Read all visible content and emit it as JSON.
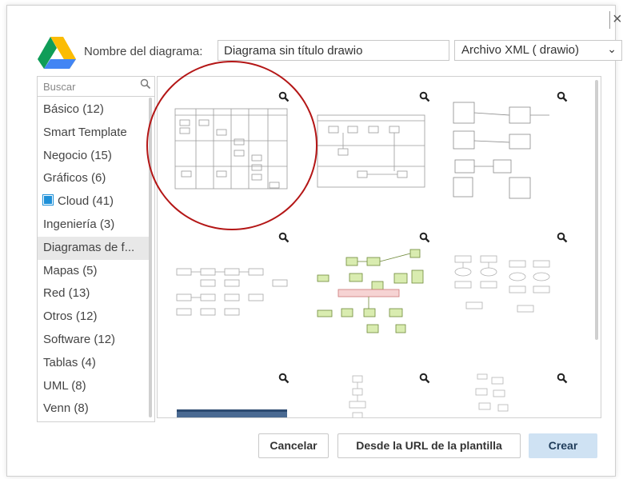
{
  "header": {
    "name_label": "Nombre del diagrama:",
    "name_value": "Diagrama sin título drawio",
    "format_value": "Archivo XML ( drawio)",
    "close_glyph": "×"
  },
  "search": {
    "placeholder": "Buscar"
  },
  "categories": [
    {
      "label": "Básico (12)"
    },
    {
      "label": "Smart Template"
    },
    {
      "label": "Negocio (15)"
    },
    {
      "label": "Gráficos (6)"
    },
    {
      "label": "Cloud (41)",
      "icon": "cloud-square-icon"
    },
    {
      "label": "Ingeniería (3)"
    },
    {
      "label": "Diagramas de f...",
      "selected": true
    },
    {
      "label": "Mapas (5)"
    },
    {
      "label": "Red (13)"
    },
    {
      "label": "Otros (12)"
    },
    {
      "label": "Software (12)"
    },
    {
      "label": "Tablas (4)"
    },
    {
      "label": "UML (8)"
    },
    {
      "label": "Venn (8)"
    }
  ],
  "buttons": {
    "cancel": "Cancelar",
    "from_url": "Desde la URL de la plantilla",
    "create": "Crear"
  },
  "colors": {
    "accent": "#cfe2f3",
    "highlight": "#b41616",
    "cloud_icon": "#1e90d8",
    "template_green": "#d9ecb0"
  }
}
